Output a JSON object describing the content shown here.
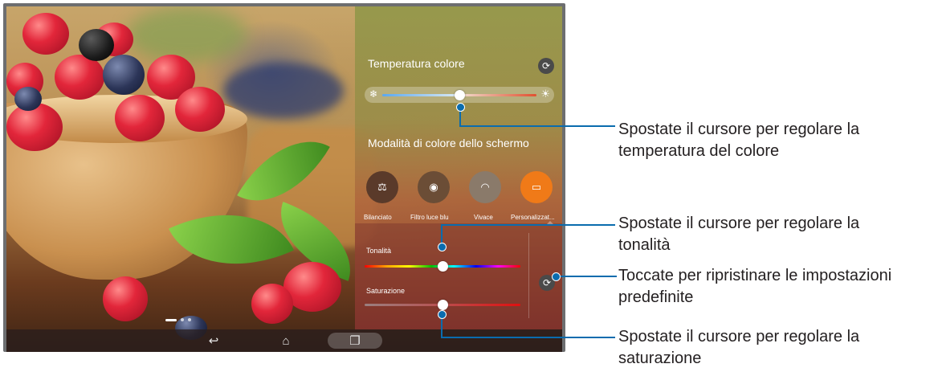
{
  "panel": {
    "temp_title": "Temperatura colore",
    "mode_title": "Modalità di colore dello schermo",
    "modes": [
      {
        "label": "Bilanciato",
        "icon": "balance-scale-icon",
        "color": "#5a3a2a"
      },
      {
        "label": "Filtro luce blu",
        "icon": "eye-shield-icon",
        "color": "#6b4d36"
      },
      {
        "label": "Vivace",
        "icon": "rainbow-icon",
        "color": "#8a7a6a"
      },
      {
        "label": "Personalizzat...",
        "icon": "custom-screen-icon",
        "color": "#f07a18"
      }
    ],
    "selected_mode": "Personalizzat...",
    "hue_label": "Tonalità",
    "saturation_label": "Saturazione",
    "temperature_level": 0.5,
    "hue_level": 0.5,
    "saturation_level": 0.5
  },
  "annotations": {
    "temperature": "Spostate il cursore per regolare la\ntemperatura del colore",
    "hue": "Spostate il cursore per regolare la\ntonalità",
    "reset": "Toccate per ripristinare le impostazioni\npredefinite",
    "saturation": "Spostate il cursore per regolare la\nsaturazione"
  },
  "navbar": {
    "back_icon": "back-icon",
    "home_icon": "home-icon",
    "recents_icon": "recents-icon"
  },
  "colors": {
    "callout": "#0a6cae",
    "accent": "#f07a18"
  }
}
